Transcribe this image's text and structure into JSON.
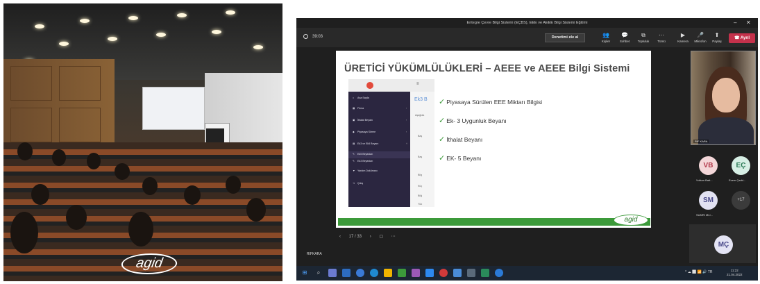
{
  "photo": {
    "logo_text": "agid"
  },
  "window": {
    "title": "Entegre Çevre Bilgi Sistemi (EÇBS), EEE ve AEEE Bilgi Sistemi Eğitimi",
    "minimize": "–",
    "close": "✕"
  },
  "toolbar": {
    "timer": "39:03",
    "admit_button": "Denetimi ele al",
    "tools": [
      {
        "icon": "people-icon",
        "glyph": "👥",
        "label": "Kişiler"
      },
      {
        "icon": "chat-icon",
        "glyph": "💬",
        "label": "Sohbet"
      },
      {
        "icon": "rooms-icon",
        "glyph": "⧉",
        "label": "Topluluk"
      },
      {
        "icon": "more-icon",
        "glyph": "⋯",
        "label": "Tümü"
      },
      {
        "icon": "camera-icon",
        "glyph": "▶",
        "label": "Kamera"
      },
      {
        "icon": "mic-icon",
        "glyph": "🎤",
        "label": "Mikrofon"
      },
      {
        "icon": "share-icon",
        "glyph": "⬆",
        "label": "Paylaş"
      }
    ],
    "leave_button": "Ayrıl"
  },
  "slide": {
    "title": "ÜRETİCİ YÜKÜMLÜLÜKLERİ – AEEE ve AEEE Bilgi Sistemi",
    "bullets": [
      "Piyasaya Sürülen EEE Miktarı Bilgisi",
      "Ek- 3 Uygunluk Beyanı",
      "İthalat Beyanı",
      "EK- 5 Beyanı"
    ],
    "logo_text": "agid",
    "app": {
      "menu": [
        {
          "icon": "⌂",
          "label": "Ana Sayfa",
          "caret": ""
        },
        {
          "icon": "▦",
          "label": "Firma",
          "caret": "‹"
        },
        {
          "icon": "▣",
          "label": "İthalat Beyanı",
          "caret": "‹"
        },
        {
          "icon": "◆",
          "label": "Piyasaya Sürme",
          "caret": "‹"
        },
        {
          "icon": "▤",
          "label": "Ek3 ve Ek5 Beyanı",
          "caret": "˅"
        },
        {
          "icon": "✎",
          "label": "Ek5 Beyanları",
          "caret": ""
        },
        {
          "icon": "✎",
          "label": "Ek3 Beyanları",
          "caret": ""
        },
        {
          "icon": "▼",
          "label": "Yardım Dokümanı",
          "caret": ""
        },
        {
          "icon": "⇥",
          "label": "Çıkış",
          "caret": ""
        }
      ],
      "main_texts": [
        "Ek3 B",
        "Aşağıda",
        "Baş",
        "Baş",
        "Bilg",
        "Küç",
        "Bilğ",
        "Yük"
      ]
    }
  },
  "slide_nav": {
    "prev": "‹",
    "page": "17 / 33",
    "next": "›",
    "more": "⋯"
  },
  "presenter_label": "RIFKARA",
  "participants": {
    "video_name": "RIF KARA",
    "avatars": [
      {
        "initials": "VB",
        "name": "Volkan Batt...",
        "bg": "#f4d7d9",
        "fg": "#b33a4c"
      },
      {
        "initials": "EÇ",
        "name": "Ecem Çadd...",
        "bg": "#d7efe5",
        "fg": "#2a7a55"
      },
      {
        "initials": "SM",
        "name": "SUMRI MLI...",
        "bg": "#e2e2f2",
        "fg": "#4a4a8a"
      },
      {
        "initials": "MÇ",
        "name": "",
        "bg": "#e4e4f4",
        "fg": "#4a4a8a"
      }
    ],
    "more_count": "+17"
  },
  "taskbar": {
    "tray": "^ ☁ ⬜ 📶 🔊 TR",
    "time": "11:22",
    "date": "21.04.2022"
  }
}
